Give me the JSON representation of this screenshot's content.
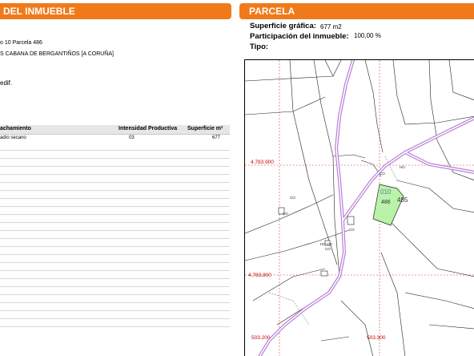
{
  "left": {
    "header": "DEL INMUEBLE",
    "location_line": "o 10 Parcela 486",
    "municipality_line": "S CABANA DE BERGANTIÑOS [A CORUÑA]",
    "edif": "edif.",
    "table": {
      "columns": [
        "achamiento",
        "Intensidad Productiva",
        "Superficie m²"
      ],
      "rows": [
        [
          "adío secano",
          "03",
          "677"
        ]
      ],
      "empty_rows": 23
    }
  },
  "right": {
    "header": "PARCELA",
    "superficie_label": "Superficie gráfica:",
    "superficie_value": "677 m2",
    "participacion_label": "Participación del inmueble:",
    "participacion_value": "100,00 %",
    "tipo_label": "Tipo:",
    "map": {
      "coord_y1": "4.783.900",
      "coord_y2": "4.783.800",
      "coord_x1": "503.200",
      "coord_x2": "503.300",
      "parcel_num": "010",
      "parcel_id": "486",
      "neighbor_id": "485",
      "labels": [
        "CO",
        "HO",
        "CO",
        "CO",
        "CO",
        "HO CO",
        "CO"
      ]
    }
  },
  "colors": {
    "header_orange": "#f07a1a",
    "parcel_green": "#b9f2a8",
    "road_purple": "#b87fd6",
    "coord_red": "#c00000"
  }
}
